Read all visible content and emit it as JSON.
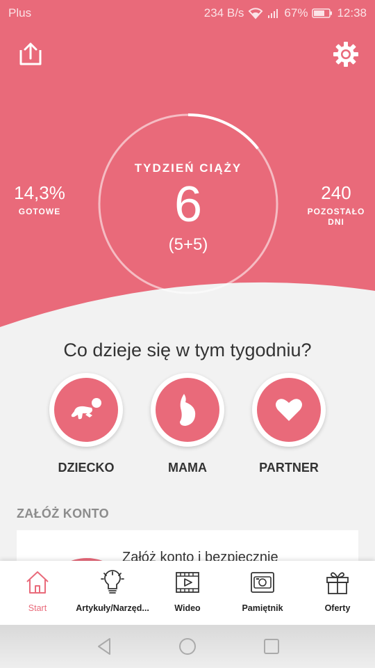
{
  "status_bar": {
    "carrier": "Plus",
    "speed": "234 B/s",
    "battery": "67%",
    "time": "12:38",
    "icons": [
      "wifi-icon",
      "signal-icon",
      "battery-icon"
    ]
  },
  "header": {
    "share_icon": "share-icon",
    "settings_icon": "gear-icon"
  },
  "progress": {
    "week_label": "TYDZIEŃ CIĄŻY",
    "week_number": "6",
    "week_detail": "(5+5)",
    "percent_done": "14,3%",
    "percent_label": "GOTOWE",
    "days_left": "240",
    "days_left_label_1": "POZOSTAŁO",
    "days_left_label_2": "DNI",
    "ring_fraction": 0.143
  },
  "this_week": {
    "question": "Co dzieje się w tym tygodniu?",
    "categories": [
      {
        "label": "DZIECKO",
        "icon": "baby-icon"
      },
      {
        "label": "MAMA",
        "icon": "pregnant-belly-icon"
      },
      {
        "label": "PARTNER",
        "icon": "heart-icon"
      }
    ]
  },
  "account": {
    "section_title": "ZAŁÓŻ KONTO",
    "card_text": "Załóż konto i bezpiecznie"
  },
  "tabs": [
    {
      "label": "Start",
      "icon": "home-icon",
      "active": true
    },
    {
      "label": "Artykuły/Narzęd...",
      "icon": "lightbulb-icon",
      "active": false
    },
    {
      "label": "Wideo",
      "icon": "video-icon",
      "active": false
    },
    {
      "label": "Pamiętnik",
      "icon": "camera-icon",
      "active": false
    },
    {
      "label": "Oferty",
      "icon": "gift-icon",
      "active": false
    }
  ],
  "colors": {
    "brand": "#e96a7a",
    "background": "#f2f2f2",
    "text": "#333333"
  }
}
